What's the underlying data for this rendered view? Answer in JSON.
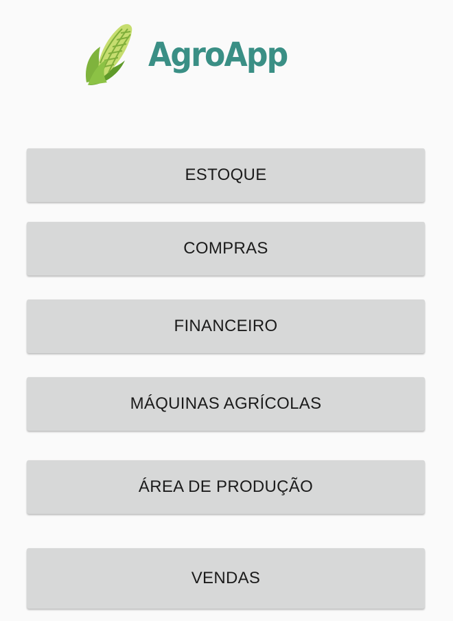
{
  "app": {
    "logo_text": "AgroApp",
    "logo_icon": "corn-icon",
    "brand_color": "#3a8f85"
  },
  "menu": {
    "items": [
      {
        "label": "ESTOQUE"
      },
      {
        "label": "COMPRAS"
      },
      {
        "label": "FINANCEIRO"
      },
      {
        "label": "MÁQUINAS AGRÍCOLAS"
      },
      {
        "label": "ÁREA DE PRODUÇÃO"
      },
      {
        "label": "VENDAS"
      }
    ]
  }
}
